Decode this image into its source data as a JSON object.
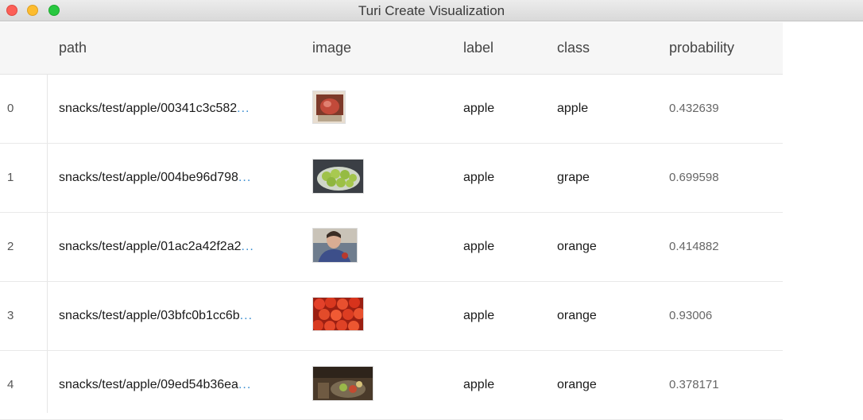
{
  "window": {
    "title": "Turi Create Visualization"
  },
  "table": {
    "columns": [
      "path",
      "image",
      "label",
      "class",
      "probability"
    ],
    "rows": [
      {
        "index": "0",
        "path": "snacks/test/apple/00341c3c582",
        "ellipsis": "...",
        "image_alt": "apple photo",
        "label": "apple",
        "class": "apple",
        "probability": "0.432639"
      },
      {
        "index": "1",
        "path": "snacks/test/apple/004be96d798",
        "ellipsis": "...",
        "image_alt": "green apples in bowl",
        "label": "apple",
        "class": "grape",
        "probability": "0.699598"
      },
      {
        "index": "2",
        "path": "snacks/test/apple/01ac2a42f2a2",
        "ellipsis": "...",
        "image_alt": "person with apple",
        "label": "apple",
        "class": "orange",
        "probability": "0.414882"
      },
      {
        "index": "3",
        "path": "snacks/test/apple/03bfc0b1cc6b",
        "ellipsis": "...",
        "image_alt": "red apples",
        "label": "apple",
        "class": "orange",
        "probability": "0.93006"
      },
      {
        "index": "4",
        "path": "snacks/test/apple/09ed54b36ea",
        "ellipsis": "...",
        "image_alt": "apples on table",
        "label": "apple",
        "class": "orange",
        "probability": "0.378171"
      }
    ]
  },
  "colors": {
    "link_ellipsis": "#3d8fd1",
    "header_bg": "#f6f6f6",
    "close": "#fc5f57",
    "minimize": "#fdbc2e",
    "maximize": "#28c840"
  }
}
